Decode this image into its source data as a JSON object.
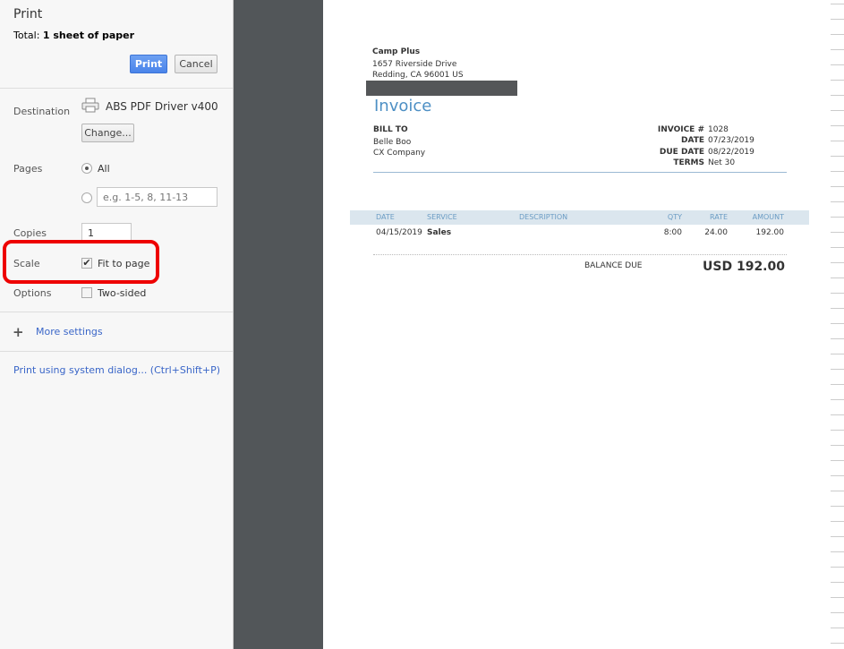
{
  "panel": {
    "title": "Print",
    "total_label": "Total:",
    "total_value": "1 sheet of paper",
    "print_button": "Print",
    "cancel_button": "Cancel",
    "destination_label": "Destination",
    "destination_value": "ABS PDF Driver v400",
    "change_button": "Change...",
    "pages_label": "Pages",
    "pages_all": "All",
    "pages_placeholder": "e.g. 1-5, 8, 11-13",
    "copies_label": "Copies",
    "copies_value": "1",
    "scale_label": "Scale",
    "fit_to_page": "Fit to page",
    "fit_to_page_checked": true,
    "options_label": "Options",
    "two_sided": "Two-sided",
    "two_sided_checked": false,
    "more_settings": "More settings",
    "system_dialog": "Print using system dialog... (Ctrl+Shift+P)"
  },
  "invoice": {
    "company": "Camp Plus",
    "address1": "1657 Riverside Drive",
    "address2": "Redding, CA  96001 US",
    "title": "Invoice",
    "bill_to_label": "BILL TO",
    "bill_to_name": "Belle Boo",
    "bill_to_company": "CX Company",
    "meta": [
      {
        "label": "INVOICE #",
        "value": "1028"
      },
      {
        "label": "DATE",
        "value": "07/23/2019"
      },
      {
        "label": "DUE DATE",
        "value": "08/22/2019"
      },
      {
        "label": "TERMS",
        "value": "Net 30"
      }
    ],
    "columns": [
      "DATE",
      "SERVICE",
      "DESCRIPTION",
      "QTY",
      "RATE",
      "AMOUNT"
    ],
    "rows": [
      {
        "date": "04/15/2019",
        "service": "Sales",
        "description": "",
        "qty": "8:00",
        "rate": "24.00",
        "amount": "192.00"
      }
    ],
    "balance_due_label": "BALANCE DUE",
    "balance_due_value": "USD 192.00"
  },
  "colors": {
    "accent": "#4a84ea",
    "invoice_blue": "#4d8fc4",
    "highlight": "#ee0000"
  }
}
